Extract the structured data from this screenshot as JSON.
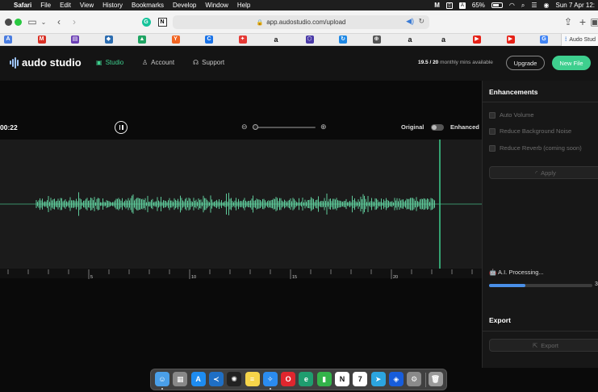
{
  "menubar": {
    "app": "Safari",
    "items": [
      "File",
      "Edit",
      "View",
      "History",
      "Bookmarks",
      "Develop",
      "Window",
      "Help"
    ],
    "battery": "65%",
    "clock": "Sun 7 Apr 12:"
  },
  "browser": {
    "url": "app.audostudio.com/upload",
    "favorites": [
      {
        "icon": "translate-icon",
        "color": "#4a7de0",
        "glyph": "A"
      },
      {
        "icon": "gmail-icon",
        "color": "#d93025",
        "glyph": "M"
      },
      {
        "icon": "forms-icon",
        "color": "#6b3fb5",
        "glyph": "▤"
      },
      {
        "icon": "cube-icon",
        "color": "#2b6cb0",
        "glyph": "◆"
      },
      {
        "icon": "drive-icon",
        "color": "#1fa463",
        "glyph": "▲"
      },
      {
        "icon": "ycombinator-icon",
        "color": "#f26522",
        "glyph": "Y"
      },
      {
        "icon": "circle-c-icon",
        "color": "#1a73e8",
        "glyph": "C"
      },
      {
        "icon": "pin-icon",
        "color": "#e53935",
        "glyph": "✦"
      },
      {
        "icon": "amazon-icon",
        "color": "#222",
        "glyph": "a"
      },
      {
        "icon": "hexagon-icon",
        "color": "#4a3aa8",
        "glyph": "⬡"
      },
      {
        "icon": "refresh-icon",
        "color": "#1e88e5",
        "glyph": "↻"
      },
      {
        "icon": "globe-icon",
        "color": "#555",
        "glyph": "⊕"
      },
      {
        "icon": "amazon-icon",
        "color": "#222",
        "glyph": "a"
      },
      {
        "icon": "amazon-icon",
        "color": "#222",
        "glyph": "a"
      },
      {
        "icon": "youtube-icon",
        "color": "#e62117",
        "glyph": "▶"
      },
      {
        "icon": "youtube-icon",
        "color": "#e62117",
        "glyph": "▶"
      },
      {
        "icon": "google-icon",
        "color": "#4285f4",
        "glyph": "G"
      }
    ],
    "active_tab": "Audo Stud"
  },
  "header": {
    "logo": "audo studio",
    "nav": [
      "Studio",
      "Account",
      "Support"
    ],
    "usage_value": "19.5 / 20",
    "usage_label": "monthly mins available",
    "upgrade": "Upgrade",
    "new_file": "New File"
  },
  "player": {
    "timecode": "00:22",
    "original_label": "Original",
    "enhanced_label": "Enhanced",
    "zoom_level": 0.0,
    "playhead_seconds": 24.8,
    "ruler_labels": [
      "5",
      "10",
      "15",
      "20"
    ]
  },
  "enhancements": {
    "title": "Enhancements",
    "options": [
      "Auto Volume",
      "Reduce Background Noise",
      "Reduce Reverb (coming soon)"
    ],
    "apply": "Apply",
    "processing_label": "A.I. Processing...",
    "progress_fraction": 0.35,
    "progress_pct_text": "3"
  },
  "export": {
    "title": "Export",
    "button": "Export"
  },
  "dock": [
    {
      "icon": "finder-icon",
      "color": "#4a9fe8",
      "glyph": "☺"
    },
    {
      "icon": "launchpad-icon",
      "color": "#888",
      "glyph": "▦"
    },
    {
      "icon": "app-store-icon",
      "color": "#1e8cf0",
      "glyph": "A"
    },
    {
      "icon": "vscode-icon",
      "color": "#1f6fc5",
      "glyph": "≺"
    },
    {
      "icon": "chatgpt-icon",
      "color": "#222",
      "glyph": "✺"
    },
    {
      "icon": "notes-icon",
      "color": "#f5d44a",
      "glyph": "≡"
    },
    {
      "icon": "safari-icon",
      "color": "#2b8cf0",
      "glyph": "✧"
    },
    {
      "icon": "opera-icon",
      "color": "#e0262e",
      "glyph": "O"
    },
    {
      "icon": "edge-icon",
      "color": "#1f9d6f",
      "glyph": "e"
    },
    {
      "icon": "numbers-icon",
      "color": "#33b34a",
      "glyph": "▮"
    },
    {
      "icon": "notion-icon",
      "color": "#fff",
      "glyph": "N"
    },
    {
      "icon": "calendar-icon",
      "color": "#fff",
      "glyph": "7"
    },
    {
      "icon": "telegram-icon",
      "color": "#2ca5e0",
      "glyph": "➤"
    },
    {
      "icon": "bitwarden-icon",
      "color": "#175ddc",
      "glyph": "◈"
    },
    {
      "icon": "system-settings-icon",
      "color": "#8a8a8a",
      "glyph": "⚙"
    },
    {
      "icon": "trash-icon",
      "color": "#9a9a9a",
      "glyph": "🗑"
    }
  ]
}
